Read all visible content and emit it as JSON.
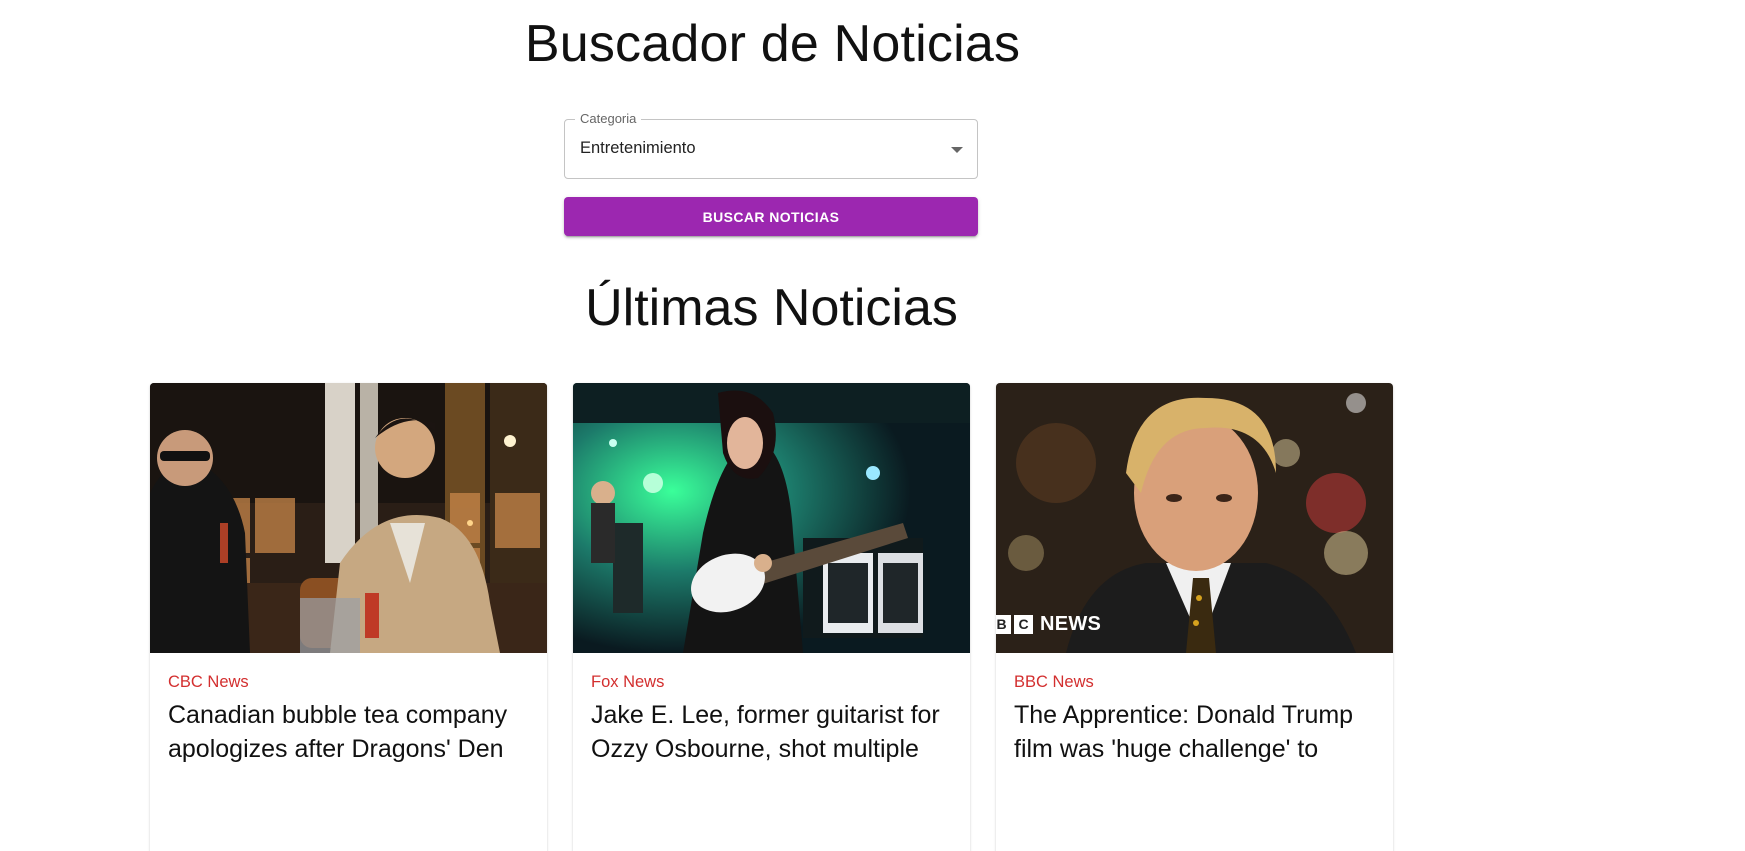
{
  "header": {
    "title": "Buscador de Noticias"
  },
  "form": {
    "category_label": "Categoria",
    "category_value": "Entretenimiento",
    "search_button": "Buscar Noticias"
  },
  "news": {
    "section_title": "Últimas Noticias",
    "articles": [
      {
        "source": "CBC News",
        "headline": "Canadian bubble tea company apologizes after Dragons' Den"
      },
      {
        "source": "Fox News",
        "headline": "Jake E. Lee, former guitarist for Ozzy Osbourne, shot multiple"
      },
      {
        "source": "BBC News",
        "headline": "The Apprentice: Donald Trump film was 'huge challenge' to",
        "image_watermark": {
          "box_1": "B",
          "box_2": "C",
          "word": "NEWS"
        }
      }
    ]
  },
  "colors": {
    "accent": "#9c27b0",
    "source_text": "#d32f2f"
  }
}
